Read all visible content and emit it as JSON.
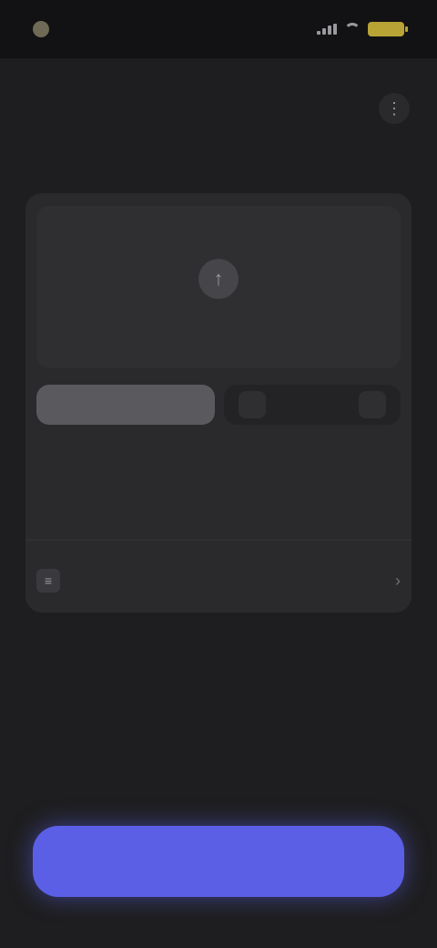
{
  "status_bar": {
    "time": "",
    "carrier": ""
  },
  "header": {
    "title": "",
    "action_icon": "more-icon"
  },
  "subtitle": "",
  "upload": {
    "icon": "upload-icon",
    "hint": ""
  },
  "segmented": {
    "active_label": "",
    "inactive_label": ""
  },
  "rows": [
    {
      "label": "",
      "value": ""
    },
    {
      "label": "",
      "value": ""
    }
  ],
  "option": {
    "icon": "options-icon",
    "label": ""
  },
  "primary_button": {
    "label": ""
  },
  "colors": {
    "background": "#1e1e20",
    "card": "#2a2a2d",
    "accent": "#5b5fe6",
    "link": "#5b5fa8",
    "battery": "#b8a436"
  }
}
